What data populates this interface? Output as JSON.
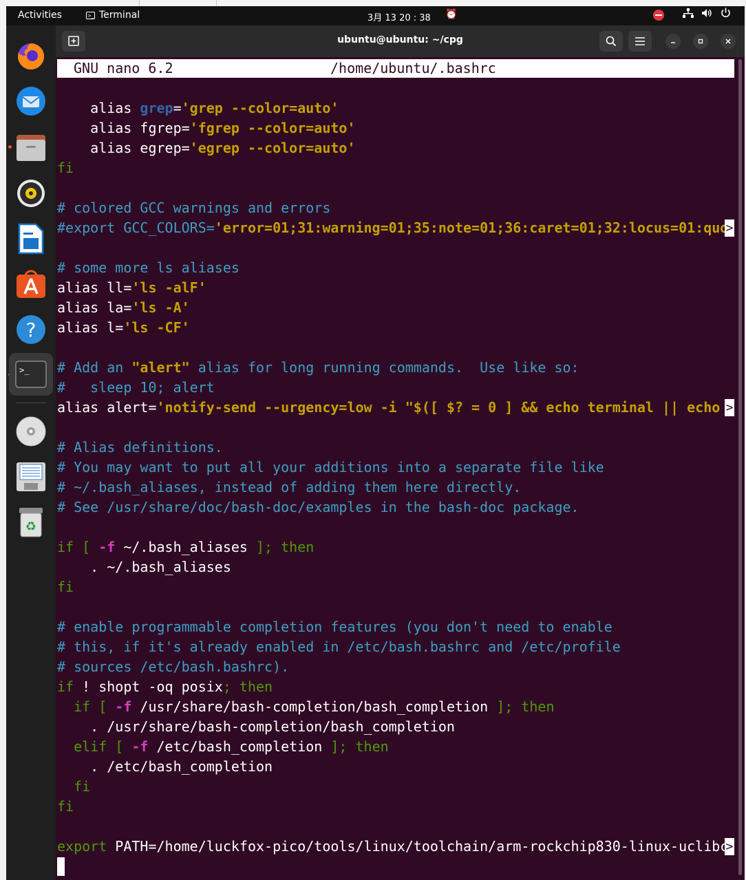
{
  "topbar": {
    "activities": "Activities",
    "app_name": "Terminal",
    "clock": "3月 13  20 : 38"
  },
  "dock": {
    "items": [
      "firefox-icon",
      "thunderbird-icon",
      "files-icon",
      "rhythmbox-icon",
      "writer-icon",
      "software-icon",
      "help-icon",
      "terminal-icon",
      "dvd-icon",
      "disk-icon",
      "trash-icon"
    ]
  },
  "window": {
    "title": "ubuntu@ubuntu: ~/cpg"
  },
  "nano": {
    "version": "GNU nano 6.2",
    "filename": "/home/ubuntu/.bashrc"
  },
  "colors": {
    "background": "#300a24",
    "keyword": "#4e9a06",
    "comment": "#3d9ec4",
    "string": "#c4a000",
    "option": "#d33fbf"
  },
  "code_lines": [
    [
      {
        "t": "    alias ",
        "c": "plain"
      },
      {
        "t": "grep",
        "c": "var"
      },
      {
        "t": "=",
        "c": "plain"
      },
      {
        "t": "'grep --color=auto'",
        "c": "str"
      }
    ],
    [
      {
        "t": "    alias fgrep",
        "c": "plain"
      },
      {
        "t": "=",
        "c": "plain"
      },
      {
        "t": "'fgrep --color=auto'",
        "c": "str"
      }
    ],
    [
      {
        "t": "    alias egrep",
        "c": "plain"
      },
      {
        "t": "=",
        "c": "plain"
      },
      {
        "t": "'egrep --color=auto'",
        "c": "str"
      }
    ],
    [
      {
        "t": "fi",
        "c": "kw"
      }
    ],
    [],
    [
      {
        "t": "# colored GCC warnings and errors",
        "c": "com"
      }
    ],
    [
      {
        "t": "#export GCC_COLORS=",
        "c": "com"
      },
      {
        "t": "'error=01;31:warning=01;35:note=01;36:caret=01;32:locus=01:quo",
        "c": "str"
      }
    ],
    [],
    [
      {
        "t": "# some more ls aliases",
        "c": "com"
      }
    ],
    [
      {
        "t": "alias ll",
        "c": "plain"
      },
      {
        "t": "=",
        "c": "plain"
      },
      {
        "t": "'ls -alF'",
        "c": "str"
      }
    ],
    [
      {
        "t": "alias la",
        "c": "plain"
      },
      {
        "t": "=",
        "c": "plain"
      },
      {
        "t": "'ls -A'",
        "c": "str"
      }
    ],
    [
      {
        "t": "alias l",
        "c": "plain"
      },
      {
        "t": "=",
        "c": "plain"
      },
      {
        "t": "'ls -CF'",
        "c": "str"
      }
    ],
    [],
    [
      {
        "t": "# Add an ",
        "c": "com"
      },
      {
        "t": "\"alert\"",
        "c": "strb"
      },
      {
        "t": " alias for long running commands.  Use like so:",
        "c": "com"
      }
    ],
    [
      {
        "t": "#   sleep 10; alert",
        "c": "com"
      }
    ],
    [
      {
        "t": "alias alert",
        "c": "plain"
      },
      {
        "t": "=",
        "c": "plain"
      },
      {
        "t": "'notify-send --urgency=low -i \"$([ $? = 0 ] && echo terminal || echo ",
        "c": "str"
      }
    ],
    [],
    [
      {
        "t": "# Alias definitions.",
        "c": "com"
      }
    ],
    [
      {
        "t": "# You may want to put all your additions into a separate file like",
        "c": "com"
      }
    ],
    [
      {
        "t": "# ~/.bash_aliases, instead of adding them here directly.",
        "c": "com"
      }
    ],
    [
      {
        "t": "# See /usr/share/doc/bash-doc/examples in the bash-doc package.",
        "c": "com"
      }
    ],
    [],
    [
      {
        "t": "if [ ",
        "c": "kw"
      },
      {
        "t": "-f",
        "c": "opt"
      },
      {
        "t": " ~/.bash_aliases ",
        "c": "plain"
      },
      {
        "t": "]; then",
        "c": "kw"
      }
    ],
    [
      {
        "t": "    . ~/.bash_aliases",
        "c": "plain"
      }
    ],
    [
      {
        "t": "fi",
        "c": "kw"
      }
    ],
    [],
    [
      {
        "t": "# enable programmable completion features (you don't need to enable",
        "c": "com"
      }
    ],
    [
      {
        "t": "# this, if it's already enabled in /etc/bash.bashrc and /etc/profile",
        "c": "com"
      }
    ],
    [
      {
        "t": "# sources /etc/bash.bashrc).",
        "c": "com"
      }
    ],
    [
      {
        "t": "if",
        "c": "kw"
      },
      {
        "t": " ! ",
        "c": "plain"
      },
      {
        "t": "shopt -oq posix",
        "c": "plain"
      },
      {
        "t": "; then",
        "c": "kw"
      }
    ],
    [
      {
        "t": "  if [ ",
        "c": "kw"
      },
      {
        "t": "-f",
        "c": "opt"
      },
      {
        "t": " /usr/share/bash-completion/bash_completion ",
        "c": "plain"
      },
      {
        "t": "]; then",
        "c": "kw"
      }
    ],
    [
      {
        "t": "    . /usr/share/bash-completion/bash_completion",
        "c": "plain"
      }
    ],
    [
      {
        "t": "  elif [ ",
        "c": "kw"
      },
      {
        "t": "-f",
        "c": "opt"
      },
      {
        "t": " /etc/bash_completion ",
        "c": "plain"
      },
      {
        "t": "]; then",
        "c": "kw"
      }
    ],
    [
      {
        "t": "    . /etc/bash_completion",
        "c": "plain"
      }
    ],
    [
      {
        "t": "  fi",
        "c": "kw"
      }
    ],
    [
      {
        "t": "fi",
        "c": "kw"
      }
    ],
    [],
    [
      {
        "t": "export",
        "c": "kw"
      },
      {
        "t": " PATH",
        "c": "plain"
      },
      {
        "t": "=/home/luckfox-pico/tools/linux/toolchain/arm-rockchip830-linux-uclibc",
        "c": "plain"
      }
    ]
  ],
  "truncated_lines": [
    6,
    15,
    37
  ],
  "trunc_marker": ">"
}
